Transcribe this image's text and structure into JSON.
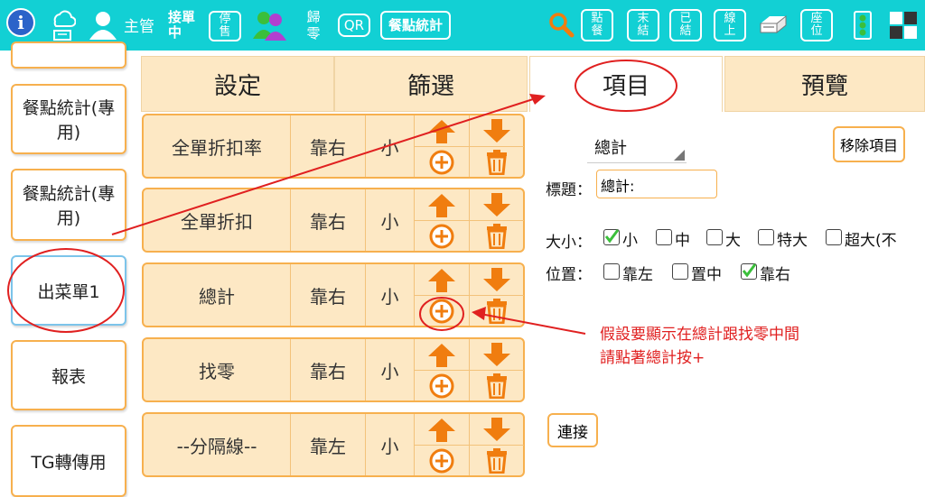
{
  "topbar": {
    "user_label": "主管",
    "take_order": "接單\n中",
    "stop_sell": "停\n售",
    "reset": "歸\n零",
    "qr": "QR",
    "meal_stats": "餐點統計",
    "btn_dine": "點\n餐",
    "btn_unsettled": "末\n結",
    "btn_settled": "已\n結",
    "btn_online": "線\n上",
    "btn_seat": "座\n位",
    "icons": [
      "info-icon",
      "cloud-pos-icon",
      "user-icon",
      "group-icon",
      "search-icon",
      "printer-icon",
      "traffic-light-icon",
      "grid-icon"
    ]
  },
  "sidebar": {
    "items": [
      {
        "label": "餐點統計(專用)"
      },
      {
        "label": "餐點統計(專用)"
      },
      {
        "label": "出菜單1"
      },
      {
        "label": "報表"
      },
      {
        "label": "TG轉傳用"
      }
    ]
  },
  "tabs": [
    "設定",
    "篩選",
    "項目",
    "預覽"
  ],
  "rows": [
    {
      "name": "全單折扣率",
      "align": "靠右",
      "size": "小"
    },
    {
      "name": "全單折扣",
      "align": "靠右",
      "size": "小"
    },
    {
      "name": "總計",
      "align": "靠右",
      "size": "小"
    },
    {
      "name": "找零",
      "align": "靠右",
      "size": "小"
    },
    {
      "name": "--分隔線--",
      "align": "靠左",
      "size": "小"
    }
  ],
  "editor": {
    "selected_item": "總計",
    "remove_label": "移除項目",
    "title_label": "標題：",
    "title_value": "總計:",
    "size_label": "大小：",
    "sizes": [
      "小",
      "中",
      "大",
      "特大",
      "超大(不"
    ],
    "size_checked": [
      true,
      false,
      false,
      false,
      false
    ],
    "pos_label": "位置：",
    "positions": [
      "靠左",
      "置中",
      "靠右"
    ],
    "pos_checked": [
      false,
      false,
      true
    ],
    "connect_label": "連接"
  },
  "annotation": {
    "line1": "假設要顯示在總計跟找零中間",
    "line2": "請點著總計按+"
  },
  "colors": {
    "bar": "#12d0d4",
    "accent": "#f07d0f",
    "tab_bg": "#fde8c4",
    "border": "#f7b04e",
    "annot": "#e02020"
  }
}
